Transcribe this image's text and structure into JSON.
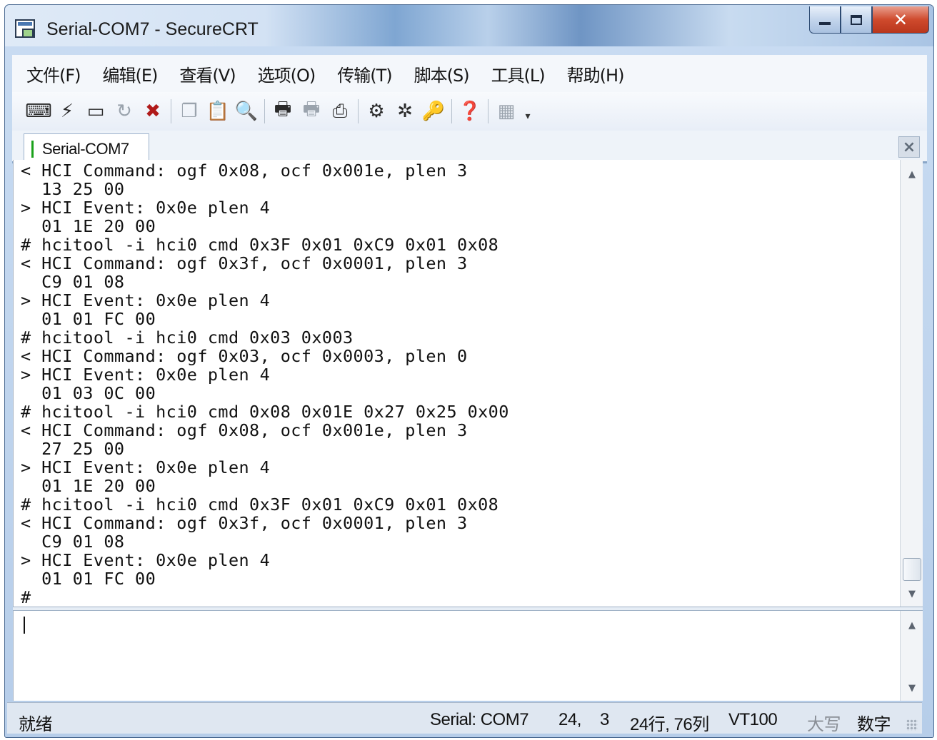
{
  "window": {
    "title": "Serial-COM7 - SecureCRT"
  },
  "menu": [
    "文件(F)",
    "编辑(E)",
    "查看(V)",
    "选项(O)",
    "传输(T)",
    "脚本(S)",
    "工具(L)",
    "帮助(H)"
  ],
  "toolbar": {
    "icons": [
      "connect-icon",
      "quick-connect-icon",
      "connect-tab-icon",
      "reconnect-icon",
      "disconnect-icon",
      "copy-icon",
      "paste-icon",
      "find-icon",
      "print-setup-icon",
      "print-selection-icon",
      "print-icon",
      "session-options-icon",
      "global-options-icon",
      "keymap-icon",
      "help-icon",
      "sftp-icon"
    ]
  },
  "tab": {
    "label": "Serial-COM7"
  },
  "terminal": {
    "lines": [
      "< HCI Command: ogf 0x08, ocf 0x001e, plen 3",
      "  13 25 00",
      "> HCI Event: 0x0e plen 4",
      "  01 1E 20 00",
      "# hcitool -i hci0 cmd 0x3F 0x01 0xC9 0x01 0x08",
      "< HCI Command: ogf 0x3f, ocf 0x0001, plen 3",
      "  C9 01 08",
      "> HCI Event: 0x0e plen 4",
      "  01 01 FC 00",
      "# hcitool -i hci0 cmd 0x03 0x003",
      "< HCI Command: ogf 0x03, ocf 0x0003, plen 0",
      "> HCI Event: 0x0e plen 4",
      "  01 03 0C 00",
      "# hcitool -i hci0 cmd 0x08 0x01E 0x27 0x25 0x00",
      "< HCI Command: ogf 0x08, ocf 0x001e, plen 3",
      "  27 25 00",
      "> HCI Event: 0x0e plen 4",
      "  01 1E 20 00",
      "# hcitool -i hci0 cmd 0x3F 0x01 0xC9 0x01 0x08",
      "< HCI Command: ogf 0x3f, ocf 0x0001, plen 3",
      "  C9 01 08",
      "> HCI Event: 0x0e plen 4",
      "  01 01 FC 00",
      "#"
    ]
  },
  "input": {
    "value": ""
  },
  "status": {
    "ready": "就绪",
    "connection": "Serial: COM7",
    "cursor_row": "24,",
    "cursor_col": "3",
    "size": "24行, 76列",
    "emulation": "VT100",
    "caps": "大写",
    "num": "数字"
  },
  "colors": {
    "accent": "#1aa11a",
    "close": "#cf4a2d"
  }
}
